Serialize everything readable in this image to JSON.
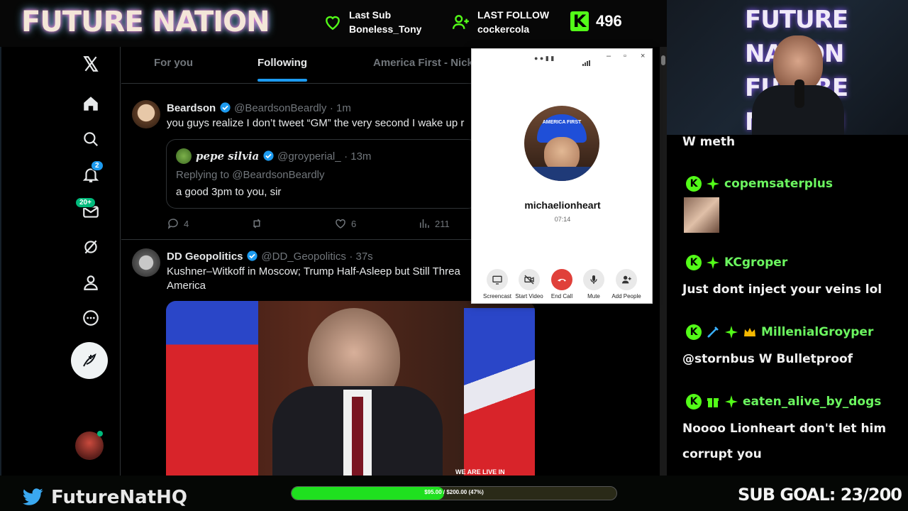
{
  "overlay": {
    "brand": "FUTURE NATION",
    "last_sub_label": "Last Sub",
    "last_sub_value": "Boneless_Tony",
    "last_follow_label": "LAST FOLLOW",
    "last_follow_value": "cockercola",
    "kick_count": "496",
    "kick_letter": "K",
    "twitter_handle": "FutureNatHQ",
    "progress_text": "$95.00 / $200.00 (47%)",
    "progress_fraction": 0.47,
    "sub_goal": "SUB GOAL: 23/200",
    "colors": {
      "kick_green": "#53fc18",
      "progress_green": "#1fe01f",
      "accent_blue": "#1d9bf0"
    }
  },
  "nav": {
    "icons": [
      "x-logo-icon",
      "home-icon",
      "search-icon",
      "notifications-icon",
      "messages-icon",
      "grok-icon",
      "profile-icon",
      "more-icon",
      "compose-icon"
    ],
    "notifications_badge": "2",
    "messages_badge": "20+"
  },
  "tabs": [
    {
      "label": "For you"
    },
    {
      "label": "Following"
    },
    {
      "label": "America First - Nick"
    }
  ],
  "tweets": [
    {
      "name": "Beardson",
      "handle": "@BeardsonBeardly",
      "time": "· 1m",
      "text": "you guys realize I don’t tweet “GM” the very second I wake up r",
      "quote": {
        "name": "pepe silvia",
        "handle": "@groyperial_",
        "time": "· 13m",
        "replying": "Replying to @BeardsonBeardly",
        "text": "a good 3pm to you, sir"
      },
      "replies": "4",
      "likes": "6",
      "views": "211"
    },
    {
      "name": "DD Geopolitics",
      "handle": "@DD_Geopolitics",
      "time": "· 37s",
      "text": "Kushner–Witkoff in Moscow; Trump Half-Asleep but Still Threa",
      "text2": "America",
      "video_caption": "WE ARE LIVE IN"
    }
  ],
  "call": {
    "contact": "michaelionheart",
    "duration": "07:14",
    "avatar_hat_text": "AMERICA FIRST",
    "buttons": [
      "Screencast",
      "Start Video",
      "End Call",
      "Mute",
      "Add People"
    ]
  },
  "chat": [
    {
      "type": "msg",
      "text": "W meth"
    },
    {
      "type": "user",
      "name": "copemsaterplus"
    },
    {
      "type": "user",
      "name": "KCgroper"
    },
    {
      "type": "msg",
      "text": "Just dont inject your veins lol"
    },
    {
      "type": "user",
      "name": "MillenialGroyper"
    },
    {
      "type": "msg",
      "text": "@stornbus W Bulletproof"
    },
    {
      "type": "user",
      "name": "eaten_alive_by_dogs"
    },
    {
      "type": "msg",
      "text": "Noooo Lionheart don't let him"
    },
    {
      "type": "msg",
      "text": "corrupt you"
    }
  ]
}
